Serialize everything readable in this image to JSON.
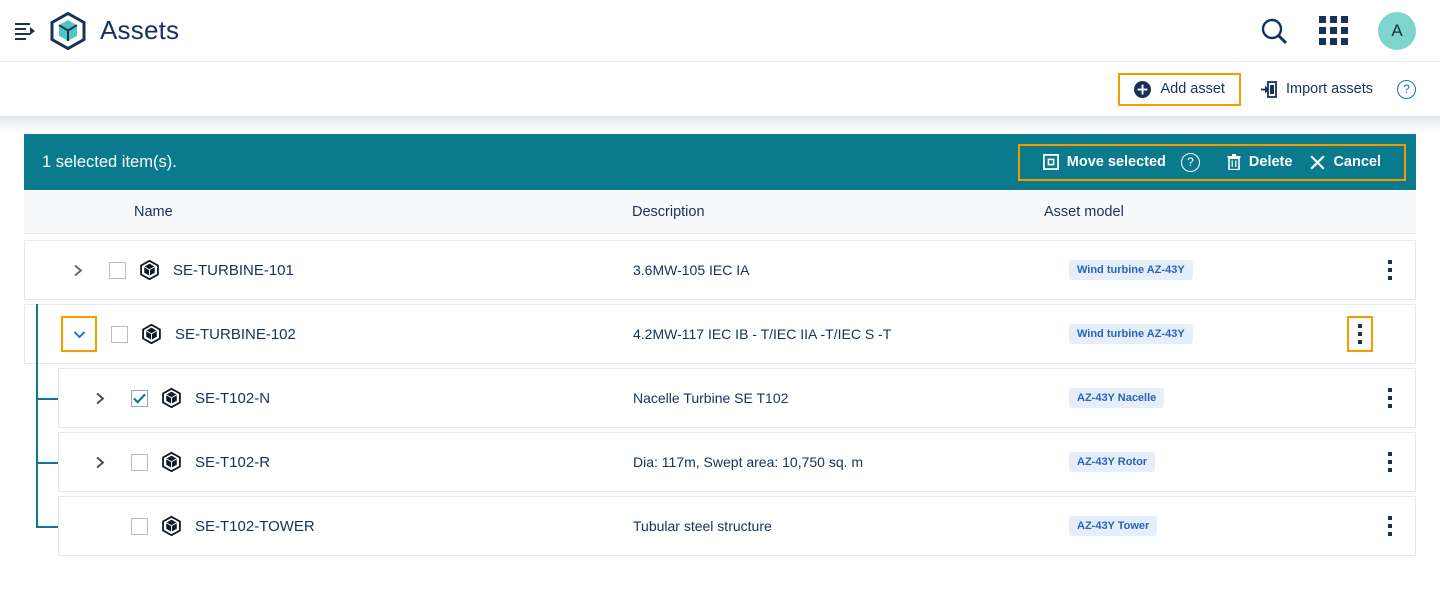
{
  "header": {
    "title": "Assets",
    "menu_icon": "hamburger-menu-icon",
    "logo_icon": "cube-logo-icon",
    "search_icon": "search-icon",
    "apps_icon": "apps-grid-icon",
    "avatar_initial": "A"
  },
  "toolbar": {
    "add_asset_label": "Add asset",
    "import_assets_label": "Import assets",
    "help_label": "?"
  },
  "selection_bar": {
    "selected_text": "1 selected item(s).",
    "move_selected_label": "Move selected",
    "help_label": "?",
    "delete_label": "Delete",
    "cancel_label": "Cancel"
  },
  "table": {
    "columns": {
      "name": "Name",
      "description": "Description",
      "asset_model": "Asset model"
    },
    "rows": [
      {
        "name": "SE-TURBINE-101",
        "description": "3.6MW-105 IEC IA",
        "asset_model": "Wind turbine AZ-43Y",
        "expanded": false,
        "has_chevron": true,
        "checked": false,
        "level": 0,
        "chevron_highlighted": false,
        "kebab_highlighted": false
      },
      {
        "name": "SE-TURBINE-102",
        "description": "4.2MW-117 IEC IB - T/IEC IIA -T/IEC S -T",
        "asset_model": "Wind turbine AZ-43Y",
        "expanded": true,
        "has_chevron": true,
        "checked": false,
        "level": 0,
        "chevron_highlighted": true,
        "kebab_highlighted": true
      },
      {
        "name": "SE-T102-N",
        "description": "Nacelle Turbine SE T102",
        "asset_model": "AZ-43Y Nacelle",
        "expanded": false,
        "has_chevron": true,
        "checked": true,
        "level": 1,
        "chevron_highlighted": false,
        "kebab_highlighted": false
      },
      {
        "name": "SE-T102-R",
        "description": "Dia: 117m, Swept area: 10,750 sq. m",
        "asset_model": "AZ-43Y Rotor",
        "expanded": false,
        "has_chevron": true,
        "checked": false,
        "level": 1,
        "chevron_highlighted": false,
        "kebab_highlighted": false
      },
      {
        "name": "SE-T102-TOWER",
        "description": "Tubular steel structure",
        "asset_model": "AZ-43Y Tower",
        "expanded": false,
        "has_chevron": false,
        "checked": false,
        "level": 1,
        "chevron_highlighted": false,
        "kebab_highlighted": false
      }
    ]
  },
  "colors": {
    "teal": "#0a7b8c",
    "navy": "#16325c",
    "highlight_orange": "#f59b00",
    "badge_bg": "#e4effb",
    "badge_text": "#2b63b8",
    "avatar_bg": "#7fd4cd"
  }
}
